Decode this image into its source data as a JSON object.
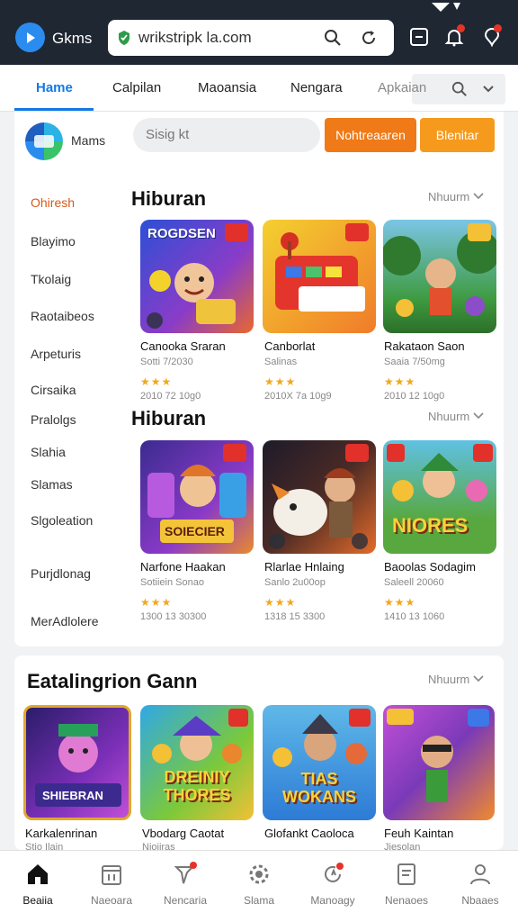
{
  "browser": {
    "brand": "Gkms",
    "url": "wrikstripk la.com"
  },
  "tabs": [
    {
      "label": "Hame"
    },
    {
      "label": "Calpilan"
    },
    {
      "label": "Maoansia"
    },
    {
      "label": "Nengara"
    },
    {
      "label": "Apkaian"
    }
  ],
  "header": {
    "brand_label": "Mams",
    "search_placeholder": "Sisig kt",
    "button_primary": "Nohtreaaren",
    "button_secondary": "Blenitar"
  },
  "sidebar": {
    "items": [
      {
        "label": "Ohiresh"
      },
      {
        "label": "Blayimo"
      },
      {
        "label": "Tkolaig"
      },
      {
        "label": "Raotaibeos"
      },
      {
        "label": "Arpeturis"
      },
      {
        "label": "Cirsaika"
      },
      {
        "label": "Pralolgs"
      },
      {
        "label": "Slahia"
      },
      {
        "label": "Slamas"
      },
      {
        "label": "Slgoleation"
      },
      {
        "label": "Purjdlonag"
      },
      {
        "label": "MerAdlolere"
      }
    ]
  },
  "sections": [
    {
      "title": "Hiburan",
      "more": "Nhuurm",
      "games": [
        {
          "art_text": "ROGDSEN",
          "name": "Canooka Sraran",
          "sub": "Sotti 7/2030",
          "stars": "★★★",
          "meta": "2010 72 10g0"
        },
        {
          "art_text": "",
          "name": "Canborlat",
          "sub": "Salinas",
          "stars": "★★★",
          "meta": "2010X 7a 10g9"
        },
        {
          "art_text": "",
          "name": "Rakataon Saon",
          "sub": "Saaia 7/50mg",
          "stars": "★★★",
          "meta": "2010 12 10g0"
        }
      ]
    },
    {
      "title": "Hiburan",
      "more": "Nhuurm",
      "games": [
        {
          "art_text": "SOIECIER",
          "name": "Narfone Haakan",
          "sub": "Sotiiein Sonao",
          "stars": "★★★",
          "meta": "1300 13 30300"
        },
        {
          "art_text": "",
          "name": "Rlarlae Hnlaing",
          "sub": "Sanlo 2u00op",
          "stars": "★★★",
          "meta": "1318 15 3300"
        },
        {
          "art_text": "NIORES",
          "name": "Baoolas Sodagim",
          "sub": "Saleell 20060",
          "stars": "★★★",
          "meta": "1410 13 1060"
        }
      ]
    }
  ],
  "section3": {
    "title": "Eatalingrion Gann",
    "more": "Nhuurm",
    "games": [
      {
        "art_text": "SHIEBRAN",
        "name": "Karkalenrinan",
        "sub": "Stio Ilain"
      },
      {
        "art_text": "DREINIY THORES",
        "name": "Vbodarg Caotat",
        "sub": "Nioiiras"
      },
      {
        "art_text": "TIAS WOKANS",
        "name": "Glofankt Caoloca",
        "sub": ""
      },
      {
        "art_text": "",
        "name": "Feuh Kaintan",
        "sub": "Jiesolan"
      }
    ]
  },
  "bottom_nav": [
    {
      "label": "Beaiia",
      "icon": "home-icon"
    },
    {
      "label": "Naeoara",
      "icon": "calendar-icon"
    },
    {
      "label": "Nencaria",
      "icon": "flag-icon"
    },
    {
      "label": "Slama",
      "icon": "gear-icon"
    },
    {
      "label": "Manoagy",
      "icon": "refresh-icon"
    },
    {
      "label": "Nenaoes",
      "icon": "document-icon"
    },
    {
      "label": "Nbaaes",
      "icon": "profile-icon"
    }
  ],
  "colors": {
    "topbar": "#1f2733",
    "accent_blue": "#1479e6",
    "accent_orange": "#ef7a17",
    "notification_red": "#e6332a"
  }
}
